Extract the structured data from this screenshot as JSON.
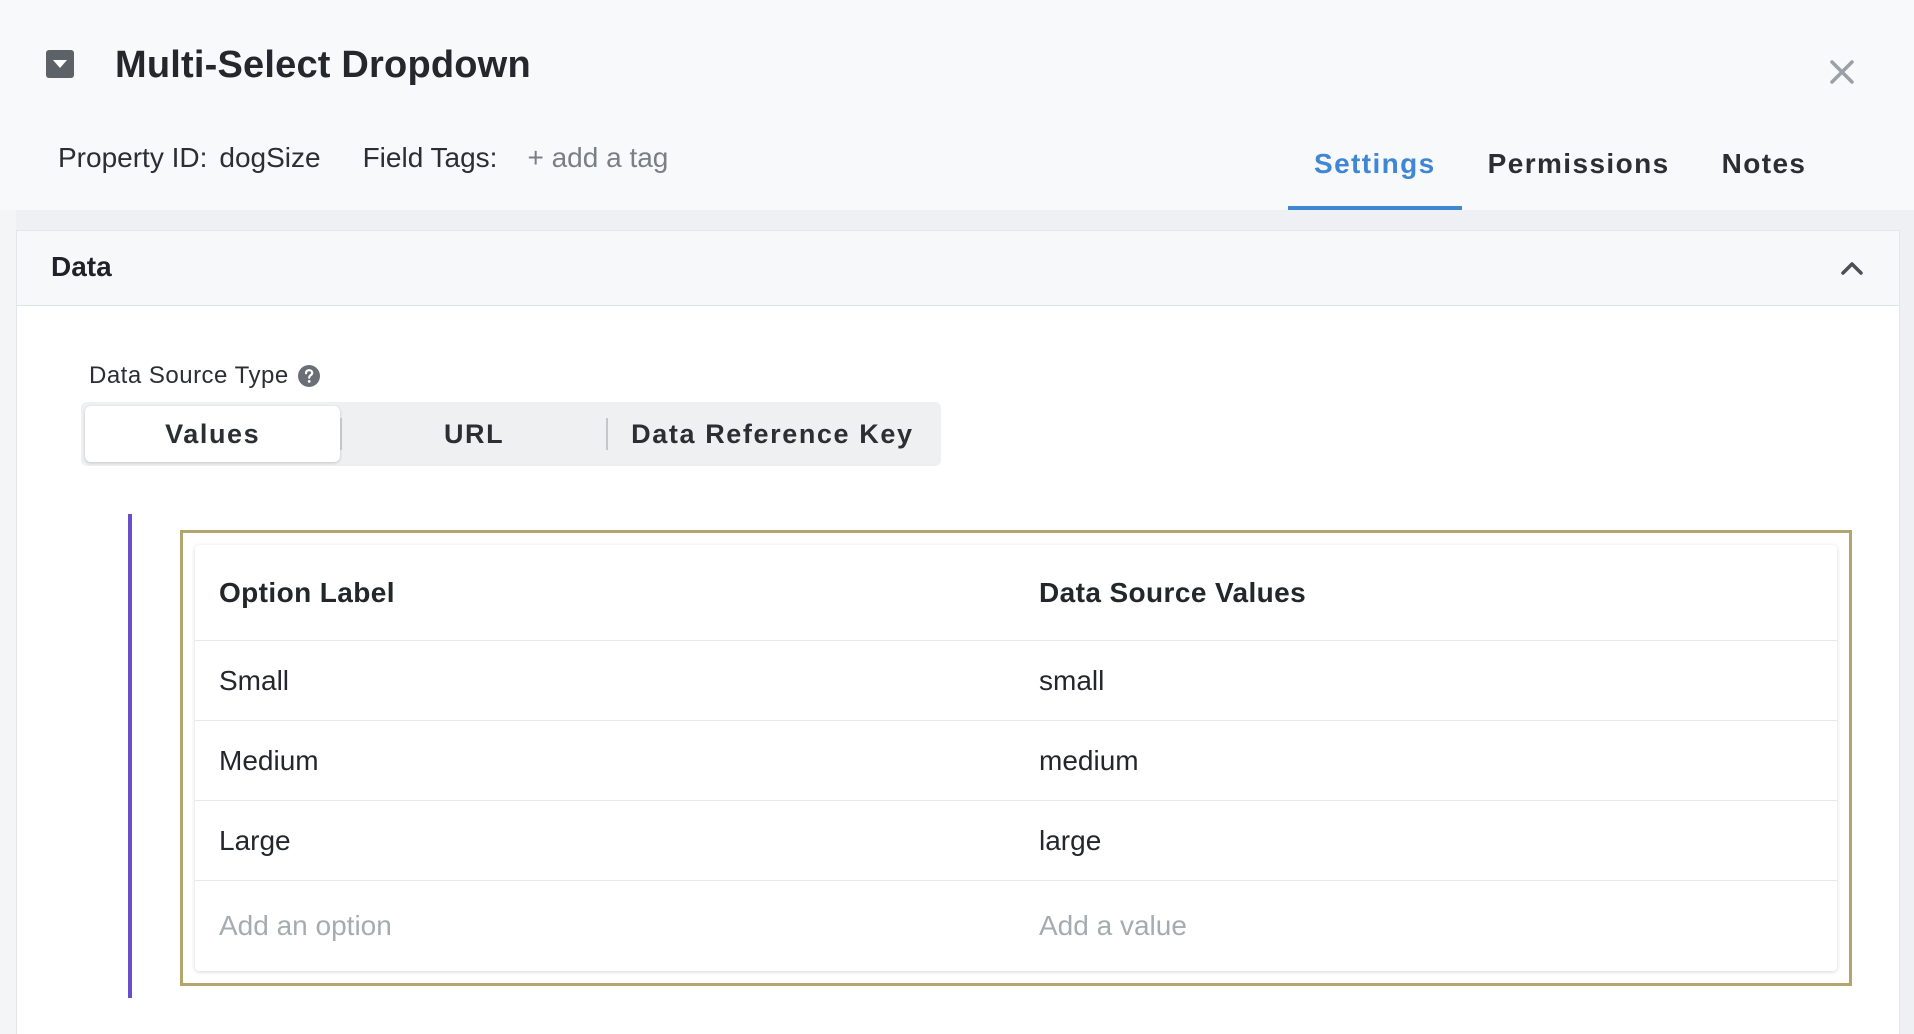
{
  "dialog": {
    "title": "Multi-Select Dropdown",
    "property_id_label": "Property ID:",
    "property_id_value": "dogSize",
    "field_tags_label": "Field Tags:",
    "add_tag_label": "+ add a tag",
    "tabs": [
      {
        "label": "Settings",
        "active": true
      },
      {
        "label": "Permissions",
        "active": false
      },
      {
        "label": "Notes",
        "active": false
      }
    ]
  },
  "data_section": {
    "title": "Data",
    "expanded": true,
    "data_source_type_label": "Data Source Type",
    "data_source_types": [
      {
        "label": "Values",
        "active": true
      },
      {
        "label": "URL",
        "active": false
      },
      {
        "label": "Data Reference Key",
        "active": false
      }
    ],
    "table": {
      "columns": [
        "Option Label",
        "Data Source Values"
      ],
      "rows": [
        [
          "Small",
          "small"
        ],
        [
          "Medium",
          "medium"
        ],
        [
          "Large",
          "large"
        ]
      ],
      "new_option_placeholder": "Add an option",
      "new_value_placeholder": "Add a value"
    }
  },
  "colors": {
    "accent_blue": "#3f86d4",
    "accent_purple": "#6b4fc8",
    "frame_gold": "#b2a56e"
  },
  "icons": {
    "dropdown": "caret-down-square-icon",
    "close": "close-icon",
    "collapse": "chevron-up-icon",
    "help": "question-circle-icon"
  }
}
